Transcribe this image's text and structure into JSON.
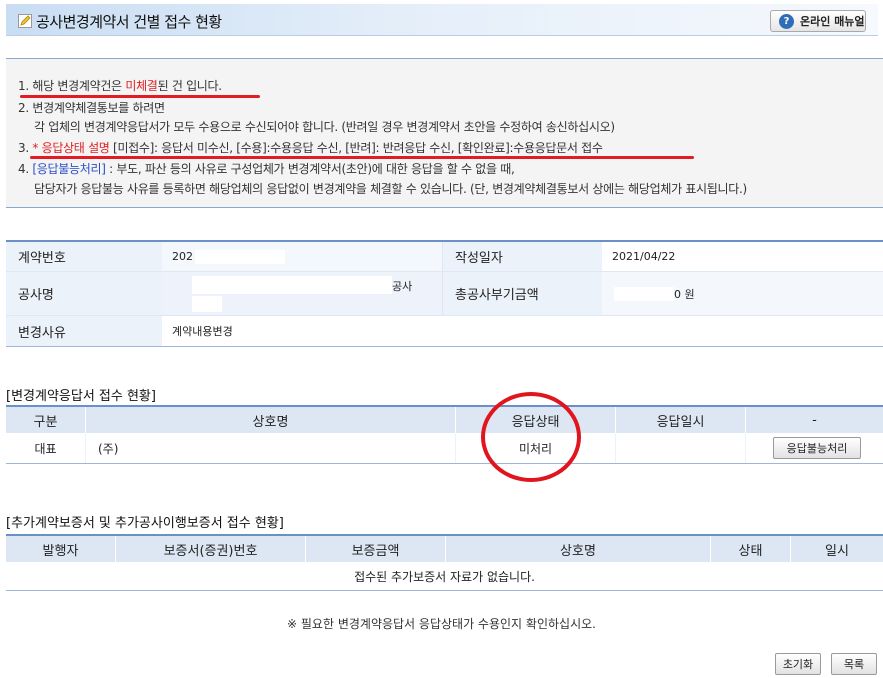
{
  "header": {
    "title": "공사변경계약서 건별 접수 현황",
    "manual_label": "온라인 매뉴얼",
    "manual_icon": "?"
  },
  "notice": {
    "l1_pre": "1. 해당 변경계약건은 ",
    "l1_red": "미체결",
    "l1_post": "된 건 입니다.",
    "l2": "2. 변경계약체결통보를 하려면",
    "l2b": "각 업체의 변경계약응답서가 모두 수용으로 수신되어야 합니다. (반려일 경우 변경계약서 초안을 수정하여 송신하십시오)",
    "l3_pre": "3. ",
    "l3_red": "* 응답상태 설명",
    "l3_post": " [미접수]: 응답서 미수신, [수용]:수용응답 수신, [반려]: 반려응답 수신, [확인완료]:수용응답문서 접수",
    "l4_pre": "4. ",
    "l4_blue": "[응답불능처리]",
    "l4_post": " : 부도, 파산 등의 사유로 구성업체가 변경계약서(초안)에 대한 응답을 할 수 없을 때,",
    "l4b": "담당자가 응답불능 사유를 등록하면 해당업체의 응답없이 변경계약을 체결할 수 있습니다. (단, 변경계약체결통보서 상에는 해당업체가 표시됩니다.)"
  },
  "info": {
    "contract_no_label": "계약번호",
    "contract_no_value": "202",
    "created_label": "작성일자",
    "created_value": "2021/04/22",
    "project_label": "공사명",
    "project_value": "공사",
    "total_label": "총공사부기금액",
    "total_value": "0 원",
    "reason_label": "변경사유",
    "reason_value": "계약내용변경"
  },
  "response": {
    "section_title": "[변경계약응답서 접수 현황]",
    "headers": [
      "구분",
      "상호명",
      "응답상태",
      "응답일시",
      "-"
    ],
    "row": {
      "type": "대표",
      "company": "(주)",
      "status": "미처리",
      "date": "",
      "action": "응답불능처리"
    }
  },
  "guarantee": {
    "section_title": "[추가계약보증서 및 추가공사이행보증서 접수 현황]",
    "headers": [
      "발행자",
      "보증서(증권)번호",
      "보증금액",
      "상호명",
      "상태",
      "일시"
    ],
    "empty_message": "접수된 추가보증서 자료가 없습니다."
  },
  "footnote": "※ 필요한 변경계약응답서 응답상태가 수용인지 확인하십시오.",
  "buttons": {
    "reset": "초기화",
    "list": "목록"
  }
}
